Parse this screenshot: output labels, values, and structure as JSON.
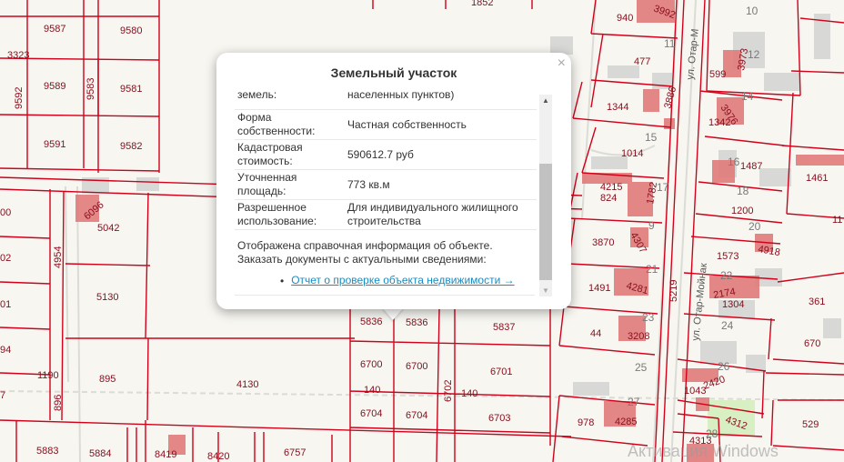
{
  "popup": {
    "title": "Земельный участок",
    "close_icon": "×",
    "rows": [
      {
        "label": "земель:",
        "value": "населенных пунктов)"
      },
      {
        "label": "Форма собственности:",
        "value": "Частная собственность"
      },
      {
        "label": "Кадастровая стоимость:",
        "value": "590612.7 руб"
      },
      {
        "label": "Уточненная площадь:",
        "value": "773 кв.м"
      },
      {
        "label": "Разрешенное использование:",
        "value": "Для индивидуального жилищного строительства"
      }
    ],
    "info_line1": "Отображена справочная информация об объекте.",
    "info_line2": "Заказать документы с актуальными сведениями:",
    "link": "Отчет о проверке объекта недвижимости →",
    "scroll_up": "▲",
    "scroll_down": "▼"
  },
  "map": {
    "colors": {
      "boundary": "#d0021b",
      "building": "#e07b7b",
      "bg": "#f7f6f1",
      "label": "#8b1020"
    },
    "streets": [
      "ул. Отар-М",
      "ул. Отар-Мойнак"
    ],
    "watermark": "Активация Windows",
    "labels": [
      "9587",
      "9580",
      "3323",
      "9592",
      "9589",
      "9583",
      "9581",
      "9591",
      "9582",
      "1852",
      "940",
      "3992",
      "10",
      "477",
      "11",
      "599",
      "3973",
      "12",
      "1344",
      "3886",
      "14",
      "1342",
      "3976",
      "15",
      "1014",
      "1487",
      "16",
      "1461",
      "824",
      "4215",
      "1782",
      "17",
      "18",
      "1200",
      "20",
      "11",
      "00",
      "6096",
      "5042",
      "4954",
      "02",
      "3870",
      "4307",
      "9",
      "1573",
      "4918",
      "01",
      "5130",
      "1491",
      "4281",
      "21",
      "5219",
      "22",
      "2174",
      "1304",
      "361",
      "5836",
      "5836",
      "5837",
      "44",
      "3208",
      "23",
      "24",
      "670",
      "94",
      "1190",
      "895",
      "4130",
      "6700",
      "6700",
      "6701",
      "25",
      "26",
      "7",
      "896",
      "140",
      "140",
      "6702",
      "1043",
      "2420",
      "6704",
      "6704",
      "6703",
      "27",
      "978",
      "4285",
      "4312",
      "529",
      "5883",
      "5884",
      "8419",
      "8420",
      "6757",
      "4313",
      "28"
    ]
  }
}
